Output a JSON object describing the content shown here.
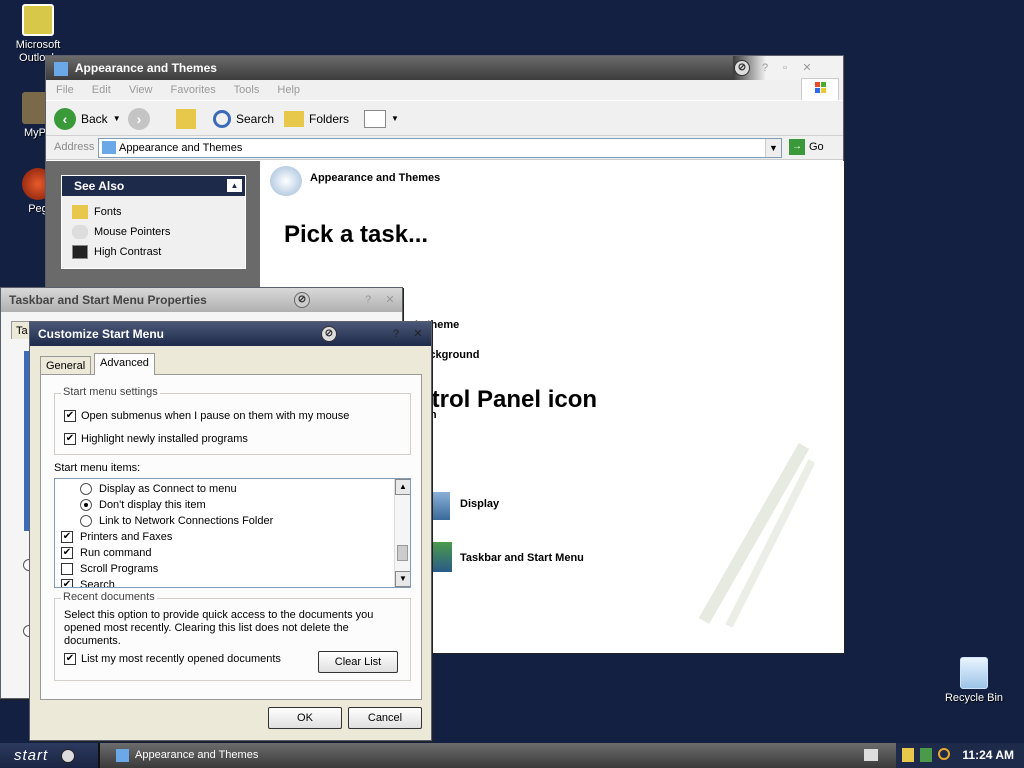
{
  "desktop": {
    "icons": [
      {
        "label": "Microsoft Outlook"
      },
      {
        "label": "MyPa"
      },
      {
        "label": "Peg"
      },
      {
        "label": "Recycle Bin"
      }
    ]
  },
  "explorer": {
    "title": "Appearance and Themes",
    "menu": [
      "File",
      "Edit",
      "View",
      "Favorites",
      "Tools",
      "Help"
    ],
    "toolbar": {
      "back": "Back",
      "search": "Search",
      "folders": "Folders"
    },
    "address": {
      "label": "Address",
      "value": "Appearance and Themes",
      "go": "Go"
    },
    "see_also": {
      "title": "See Also",
      "items": [
        "Fonts",
        "Mouse Pointers",
        "High Contrast"
      ]
    },
    "content": {
      "header": "Appearance and Themes",
      "pick_task": "Pick a task...",
      "tasks": [
        "Change the computer's theme",
        "op background",
        "olution"
      ],
      "pick_icon": "ntrol Panel icon",
      "icons": [
        "Display",
        "Taskbar and Start Menu"
      ]
    }
  },
  "taskbar_props": {
    "title": "Taskbar and Start Menu Properties",
    "tab_partial": "Ta"
  },
  "customize": {
    "title": "Customize Start Menu",
    "tabs": [
      "General",
      "Advanced"
    ],
    "start_menu_settings": {
      "label": "Start menu settings",
      "items": [
        {
          "label": "Open submenus when I pause on them with my mouse",
          "checked": true
        },
        {
          "label": "Highlight newly installed programs",
          "checked": true
        }
      ]
    },
    "start_menu_items": {
      "label": "Start menu items:",
      "list": [
        {
          "type": "radio",
          "label": "Display as Connect to menu",
          "checked": false,
          "indent": true
        },
        {
          "type": "radio",
          "label": "Don't display this item",
          "checked": true,
          "indent": true
        },
        {
          "type": "radio",
          "label": "Link to Network Connections Folder",
          "checked": false,
          "indent": true
        },
        {
          "type": "check",
          "label": "Printers and Faxes",
          "checked": true,
          "indent": false
        },
        {
          "type": "check",
          "label": "Run command",
          "checked": true,
          "indent": false
        },
        {
          "type": "check",
          "label": "Scroll Programs",
          "checked": false,
          "indent": false
        },
        {
          "type": "check",
          "label": "Search",
          "checked": true,
          "indent": false
        }
      ]
    },
    "recent": {
      "label": "Recent documents",
      "description": "Select this option to provide quick access to the documents you opened most recently.  Clearing this list does not delete the documents.",
      "checkbox": "List my most recently opened documents",
      "checkbox_checked": true,
      "clear": "Clear List"
    },
    "ok": "OK",
    "cancel": "Cancel"
  },
  "taskbar": {
    "start": "start",
    "task": "Appearance and Themes",
    "clock": "11:24 AM"
  }
}
